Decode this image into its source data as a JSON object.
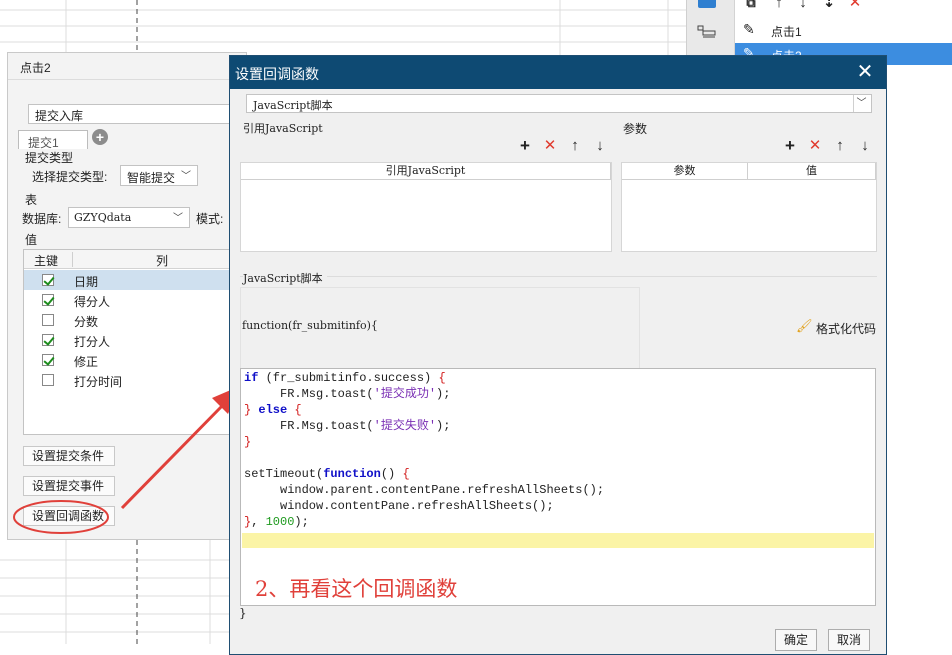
{
  "right_panel": {
    "items": [
      {
        "label": "点击1"
      },
      {
        "label": "点击2"
      }
    ]
  },
  "under_dialog": {
    "title": "点击2",
    "action_name": "提交入库",
    "tab_label": "提交1",
    "submit_type_section": "提交类型",
    "submit_type_label": "选择提交类型:",
    "submit_type_value": "智能提交",
    "table_section": "表",
    "database_label": "数据库:",
    "database_value": "GZYQdata",
    "mode_label": "模式:",
    "value_section": "值",
    "columns": {
      "primary_key": "主键",
      "column": "列"
    },
    "rows": [
      {
        "name": "日期",
        "checked": true
      },
      {
        "name": "得分人",
        "checked": true
      },
      {
        "name": "分数",
        "checked": false
      },
      {
        "name": "打分人",
        "checked": true
      },
      {
        "name": "修正",
        "checked": true
      },
      {
        "name": "打分时间",
        "checked": false
      }
    ],
    "btn_submit_condition": "设置提交条件",
    "btn_submit_event": "设置提交事件",
    "btn_callback": "设置回调函数"
  },
  "main_dialog": {
    "title": "设置回调函数",
    "type_value": "JavaScript脚本",
    "ref_js_label": "引用JavaScript",
    "ref_js_column": "引用JavaScript",
    "params_label": "参数",
    "params_column_param": "参数",
    "params_column_value": "值",
    "script_label": "JavaScript脚本",
    "function_header": "function(fr_submitinfo){",
    "format_code_label": "格式化代码",
    "closing_brace": "}",
    "ok_label": "确定",
    "cancel_label": "取消",
    "code": {
      "line1_kw": "if",
      "line1_a": " (fr_submitinfo.success) ",
      "line1_br": "{",
      "line2_a": "     FR.Msg.toast(",
      "line2_str": "'提交成功'",
      "line2_b": ");",
      "line3_br1": "}",
      "line3_kw": " else ",
      "line3_br2": "{",
      "line4_a": "     FR.Msg.toast(",
      "line4_str": "'提交失败'",
      "line4_b": ");",
      "line5_br": "}",
      "line7_a": "setTimeout(",
      "line7_kw": "function",
      "line7_b": "() ",
      "line7_br": "{",
      "line8": "     window.parent.contentPane.refreshAllSheets();",
      "line9": "     window.contentPane.refreshAllSheets();",
      "line10_br": "}",
      "line10_a": ", ",
      "line10_num": "1000",
      "line10_b": ");"
    }
  },
  "annotation": {
    "text": "2、再看这个回调函数"
  },
  "colors": {
    "titlebar": "#0e4a73",
    "annotation_red": "#e0403a",
    "selected_row": "#cfe0ef",
    "highlight_line": "#fbf4a6"
  }
}
